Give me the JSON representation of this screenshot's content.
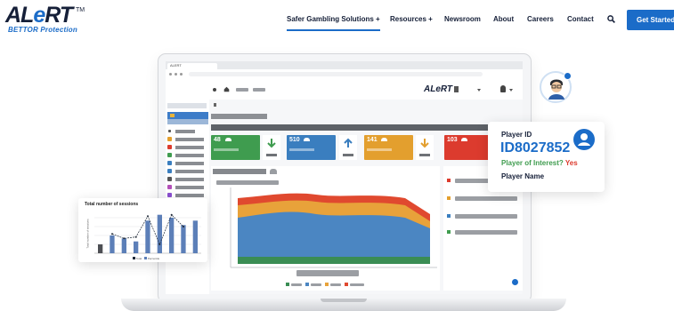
{
  "brand": {
    "logo_text": "ALeRT",
    "logo_tm": "TM",
    "tagline": "BETTOR Protection"
  },
  "nav": {
    "items": [
      {
        "label": "Safer Gambling Solutions +",
        "active": true
      },
      {
        "label": "Resources +"
      },
      {
        "label": "Newsroom"
      },
      {
        "label": "About"
      },
      {
        "label": "Careers"
      },
      {
        "label": "Contact"
      }
    ],
    "search_icon": "search-icon",
    "cta_label": "Get Started"
  },
  "dashboard": {
    "window_title": "ALERT",
    "app_logo_text": "ALeRT",
    "kpis": [
      {
        "value": "48",
        "color": "#3f9c4f",
        "icon": "users-icon"
      },
      {
        "value": "510",
        "color": "#3a7ebf",
        "icon": "users-icon"
      },
      {
        "value": "141",
        "color": "#e39f2e",
        "icon": "users-icon"
      },
      {
        "value": "103",
        "color": "#dc3b2e",
        "icon": "users-icon"
      }
    ],
    "trend_icons": [
      {
        "icon": "arrow-down-icon",
        "color": "#3f9c4f"
      },
      {
        "icon": "arrow-up-icon",
        "color": "#3a7ebf"
      },
      {
        "icon": "arrow-down-icon",
        "color": "#e39f2e"
      }
    ],
    "area_colors": [
      "#3a8d54",
      "#4b86c2",
      "#e8a23a",
      "#e0492f"
    ],
    "legend_colors": [
      "#3a8d54",
      "#4b86c2",
      "#e8a23a",
      "#e0492f"
    ],
    "help_icon": "help-icon"
  },
  "sessions_card": {
    "title": "Total number of sessions",
    "y_label": "Total number of sessions",
    "legend": [
      "Total",
      "Percentile"
    ],
    "chart_data": {
      "type": "bar",
      "bars": [
        6,
        12,
        10,
        8,
        22,
        26,
        24,
        19,
        22
      ],
      "line": [
        null,
        13,
        10,
        11,
        25,
        6,
        26,
        18,
        null
      ],
      "colors": {
        "bar": "#5c7fb8",
        "highlight": "#4d4f54",
        "line": "#1f2937"
      }
    }
  },
  "player_card": {
    "id_label": "Player ID",
    "id_value": "ID8027852",
    "interest_label": "Player of Interest?",
    "interest_value": "Yes",
    "name_label": "Player Name",
    "avatar_icon": "user-circle-icon",
    "colors": {
      "id": "#1b6cc8",
      "interest": "#3f9c4f",
      "yes": "#dc3b2e"
    }
  },
  "avatar": {
    "icon": "agent-avatar-icon"
  }
}
